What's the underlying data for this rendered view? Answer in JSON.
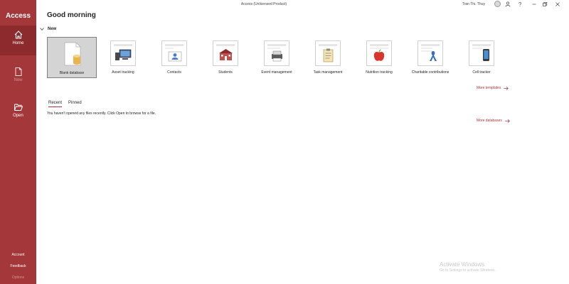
{
  "app": {
    "name": "Access",
    "window_title": "Access (Unlicensed Product)",
    "user_name": "Tran Thi. Thuy"
  },
  "sidebar": {
    "items": [
      {
        "label": "Home",
        "icon": "home-icon",
        "active": true
      },
      {
        "label": "New",
        "icon": "new-file-icon",
        "disabled": true
      },
      {
        "label": "Open",
        "icon": "open-folder-icon"
      }
    ],
    "bottom": [
      {
        "label": "Account"
      },
      {
        "label": "Feedback"
      },
      {
        "label": "Options",
        "disabled": true
      }
    ]
  },
  "main": {
    "greeting": "Good morning",
    "new_section_label": "New",
    "templates": [
      {
        "label": "Blank database",
        "icon": "blank-database-icon",
        "selected": true
      },
      {
        "label": "Asset tracking",
        "icon": "asset-tracking-icon"
      },
      {
        "label": "Contacts",
        "icon": "contacts-icon"
      },
      {
        "label": "Students",
        "icon": "students-icon"
      },
      {
        "label": "Event management",
        "icon": "event-management-icon"
      },
      {
        "label": "Task management",
        "icon": "task-management-icon"
      },
      {
        "label": "Nutrition tracking",
        "icon": "nutrition-tracking-icon"
      },
      {
        "label": "Charitable contributions",
        "icon": "charitable-contributions-icon"
      },
      {
        "label": "Cell tracker",
        "icon": "cell-tracker-icon"
      }
    ],
    "more_templates_label": "More templates",
    "tabs": [
      {
        "label": "Recent",
        "active": true
      },
      {
        "label": "Pinned"
      }
    ],
    "empty_message": "You haven't opened any files recently. Click Open to browse for a file.",
    "more_databases_label": "More databases"
  },
  "watermark": {
    "title": "Activate Windows",
    "subtitle": "Go to Settings to activate Windows."
  },
  "colors": {
    "brand": "#a4373a",
    "brand_dark": "#8c2a2d"
  }
}
